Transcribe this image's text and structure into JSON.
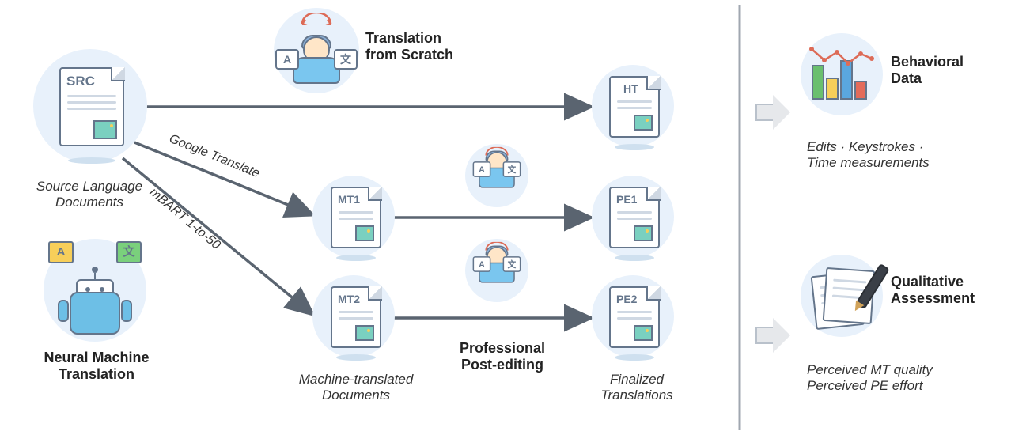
{
  "source": {
    "doc_label": "SRC",
    "caption": "Source Language\nDocuments"
  },
  "nmt": {
    "robot_cardA": "A",
    "robot_cardZ": "文",
    "label": "Neural Machine\nTranslation"
  },
  "edges": {
    "google_translate": "Google Translate",
    "mbart": "mBART 1-to-50"
  },
  "mt": {
    "mt1_label": "MT1",
    "mt2_label": "MT2",
    "caption": "Machine-translated\nDocuments"
  },
  "translator": {
    "cardA": "A",
    "cardZ": "文"
  },
  "from_scratch": {
    "title": "Translation\nfrom Scratch"
  },
  "post_editing": {
    "title": "Professional\nPost-editing"
  },
  "final": {
    "ht_label": "HT",
    "pe1_label": "PE1",
    "pe2_label": "PE2",
    "caption": "Finalized\nTranslations"
  },
  "behavioral": {
    "title": "Behavioral\nData",
    "detail": "Edits · Keystrokes ·\nTime measurements"
  },
  "qualitative": {
    "title": "Qualitative\nAssessment",
    "detail": "Perceived MT quality\nPerceived PE effort"
  }
}
